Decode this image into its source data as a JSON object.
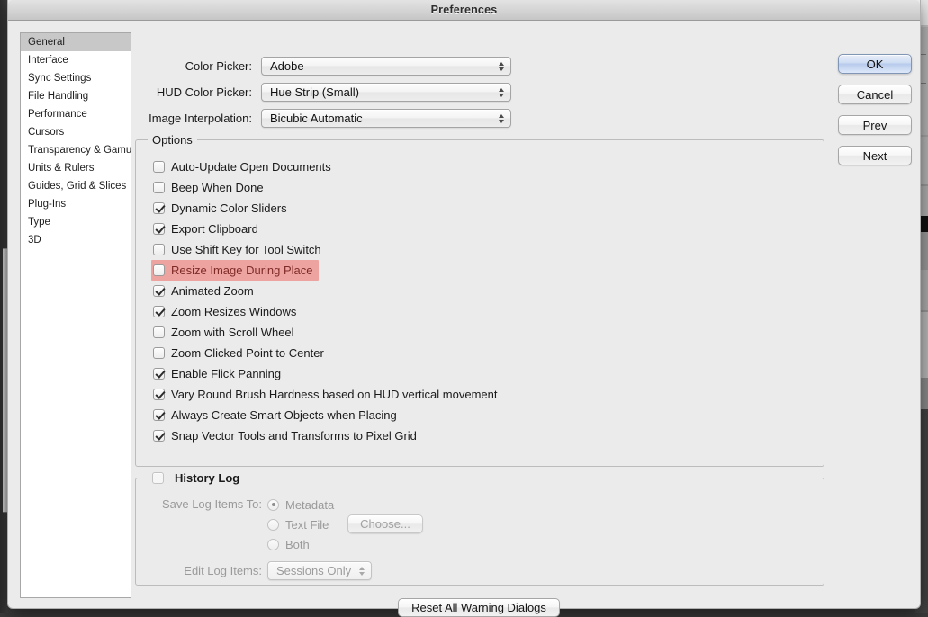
{
  "window": {
    "title": "Preferences"
  },
  "sidebar": {
    "items": [
      {
        "label": "General",
        "selected": true
      },
      {
        "label": "Interface",
        "selected": false
      },
      {
        "label": "Sync Settings",
        "selected": false
      },
      {
        "label": "File Handling",
        "selected": false
      },
      {
        "label": "Performance",
        "selected": false
      },
      {
        "label": "Cursors",
        "selected": false
      },
      {
        "label": "Transparency & Gamut",
        "selected": false
      },
      {
        "label": "Units & Rulers",
        "selected": false
      },
      {
        "label": "Guides, Grid & Slices",
        "selected": false
      },
      {
        "label": "Plug-Ins",
        "selected": false
      },
      {
        "label": "Type",
        "selected": false
      },
      {
        "label": "3D",
        "selected": false
      }
    ]
  },
  "top_settings": [
    {
      "label": "Color Picker:",
      "value": "Adobe"
    },
    {
      "label": "HUD Color Picker:",
      "value": "Hue Strip (Small)"
    },
    {
      "label": "Image Interpolation:",
      "value": "Bicubic Automatic"
    }
  ],
  "options_group": {
    "title": "Options",
    "items": [
      {
        "label": "Auto-Update Open Documents",
        "checked": false,
        "highlighted": false
      },
      {
        "label": "Beep When Done",
        "checked": false,
        "highlighted": false
      },
      {
        "label": "Dynamic Color Sliders",
        "checked": true,
        "highlighted": false
      },
      {
        "label": "Export Clipboard",
        "checked": true,
        "highlighted": false
      },
      {
        "label": "Use Shift Key for Tool Switch",
        "checked": false,
        "highlighted": false
      },
      {
        "label": "Resize Image During Place",
        "checked": false,
        "highlighted": true
      },
      {
        "label": "Animated Zoom",
        "checked": true,
        "highlighted": false
      },
      {
        "label": "Zoom Resizes Windows",
        "checked": true,
        "highlighted": false
      },
      {
        "label": "Zoom with Scroll Wheel",
        "checked": false,
        "highlighted": false
      },
      {
        "label": "Zoom Clicked Point to Center",
        "checked": false,
        "highlighted": false
      },
      {
        "label": "Enable Flick Panning",
        "checked": true,
        "highlighted": false
      },
      {
        "label": "Vary Round Brush Hardness based on HUD vertical movement",
        "checked": true,
        "highlighted": false
      },
      {
        "label": "Always Create Smart Objects when Placing",
        "checked": true,
        "highlighted": false
      },
      {
        "label": "Snap Vector Tools and Transforms to Pixel Grid",
        "checked": true,
        "highlighted": false
      }
    ]
  },
  "history_log": {
    "title": "History Log",
    "enabled": false,
    "save_log_items_label": "Save Log Items To:",
    "radios": [
      {
        "label": "Metadata",
        "selected": true
      },
      {
        "label": "Text File",
        "selected": false
      },
      {
        "label": "Both",
        "selected": false
      }
    ],
    "choose_button": "Choose...",
    "edit_log_items_label": "Edit Log Items:",
    "edit_log_items_value": "Sessions Only"
  },
  "buttons": {
    "ok": "OK",
    "cancel": "Cancel",
    "prev": "Prev",
    "next": "Next",
    "reset": "Reset All Warning Dialogs"
  },
  "colors": {
    "highlight": "#eda3a0",
    "highlight_text": "#7e2b28",
    "dialog_bg": "#ebebeb",
    "selection_bg": "#c8c8c8",
    "default_button": "#b8cbec"
  }
}
